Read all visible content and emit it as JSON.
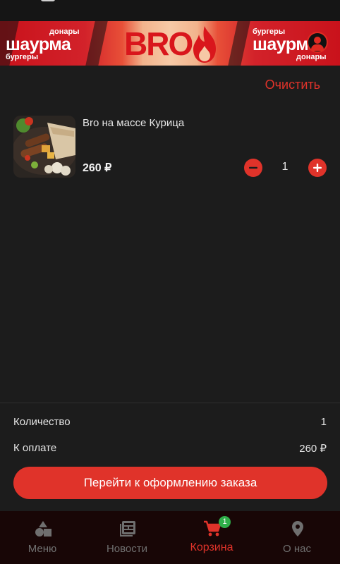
{
  "banner": {
    "left_big": "шаурма",
    "left_top": "донары",
    "left_bottom": "бургеры",
    "logo": "BRO",
    "right_big": "шаурма",
    "right_top": "бургеры",
    "right_bottom": "донары"
  },
  "cart": {
    "clear_label": "Очистить",
    "items": [
      {
        "name": "Bro на массе Курица",
        "price": "260 ₽",
        "quantity": "1"
      }
    ]
  },
  "summary": {
    "quantity_label": "Количество",
    "quantity_value": "1",
    "total_label": "К оплате",
    "total_value": "260 ₽",
    "checkout_label": "Перейти к оформлению заказа"
  },
  "tabbar": {
    "tabs": [
      {
        "label": "Меню",
        "icon": "menu-shapes-icon"
      },
      {
        "label": "Новости",
        "icon": "news-icon"
      },
      {
        "label": "Корзина",
        "icon": "cart-icon",
        "badge": "1",
        "active": true
      },
      {
        "label": "О нас",
        "icon": "location-pin-icon"
      }
    ]
  },
  "colors": {
    "accent": "#e0332a",
    "background": "#1c1c1c",
    "tabbar": "#180606",
    "badge": "#2fae4a",
    "inactive": "#6f6f6f"
  }
}
